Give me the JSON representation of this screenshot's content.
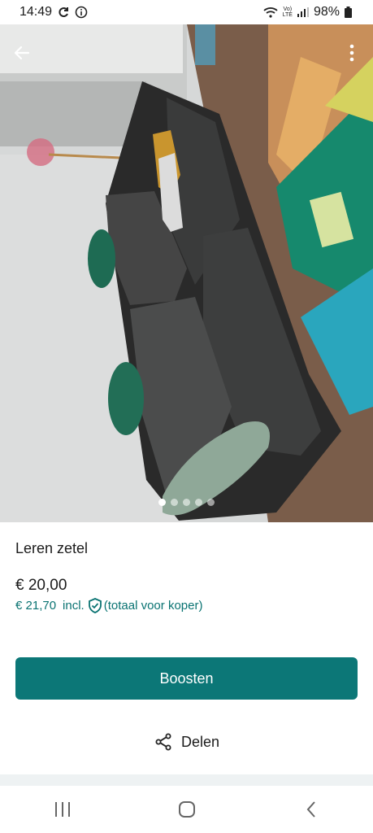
{
  "status": {
    "time": "14:49",
    "network": "LTE",
    "volte": "Vo)",
    "battery": "98%"
  },
  "icons": {
    "back": "arrow-left-icon",
    "more": "more-vertical-icon",
    "share": "share-icon",
    "shield": "shield-check-icon"
  },
  "gallery": {
    "count": 5,
    "active": 1
  },
  "listing": {
    "title": "Leren zetel",
    "price": "€ 20,00",
    "buyer_price": "€ 21,70",
    "incl": "incl.",
    "buyer_note": "(totaal voor koper)"
  },
  "actions": {
    "boost_label": "Boosten",
    "share_label": "Delen"
  },
  "colors": {
    "accent": "#0c7777",
    "accent_text": "#0a7372"
  }
}
